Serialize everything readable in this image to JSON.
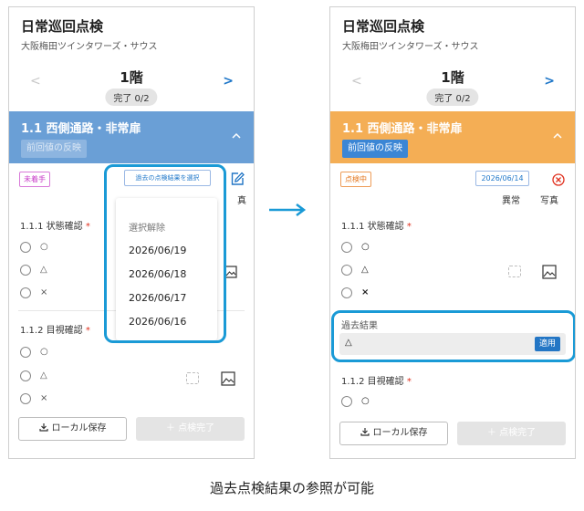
{
  "app": {
    "title": "日常巡回点検",
    "building": "大阪梅田ツインタワーズ・サウス",
    "floor": "1階",
    "progress": "完了 0/2",
    "nav_prev": "<",
    "nav_next": ">",
    "section_title": "1.1 西側通路・非常扉",
    "prev_value_button": "前回値の反映",
    "q1_label": "1.1.1 状態確認",
    "q2_label": "1.1.2 目視確認",
    "required_mark": "*",
    "options": [
      "○",
      "△",
      "×"
    ],
    "local_save": "ローカル保存",
    "complete": "＋ 点検完了"
  },
  "left_screen": {
    "status": "未着手",
    "select_past_button": "過去の点検結果を選択",
    "dropdown": {
      "clear": "選択解除",
      "dates": [
        "2026/06/19",
        "2026/06/18",
        "2026/06/17",
        "2026/06/16"
      ]
    },
    "column_photo_partial": "真"
  },
  "right_screen": {
    "status": "点検中",
    "selected_date": "2026/06/14",
    "column_abnormal": "異常",
    "column_photo": "写真",
    "past_result_label": "過去結果",
    "past_result_value": "△",
    "apply_button": "適用"
  },
  "caption": "過去点検結果の参照が可能",
  "colors": {
    "accent_blue": "#2376c5",
    "section_blue": "#6a9fd6",
    "section_orange": "#f4ae55",
    "highlight": "#1a9ad6"
  }
}
